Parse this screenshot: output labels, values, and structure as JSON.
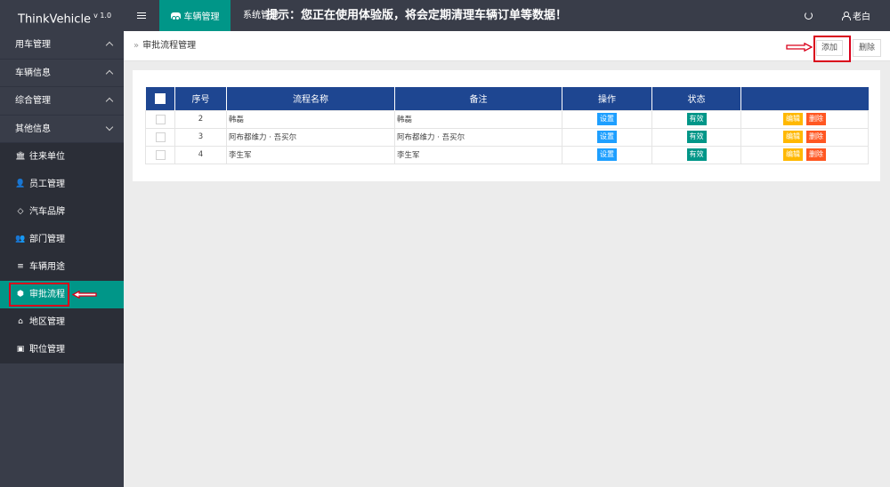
{
  "header": {
    "logo": "ThinkVehicle",
    "version": "v 1.0",
    "active_tab": "车辆管理",
    "system_tab": "系统管理",
    "notice": "提示：您正在使用体验版，将会定期清理车辆订单等数据！",
    "user_name": "老白"
  },
  "sidebar": {
    "groups": [
      {
        "label": "用车管理",
        "expanded": false
      },
      {
        "label": "车辆信息",
        "expanded": false
      },
      {
        "label": "综合管理",
        "expanded": false
      },
      {
        "label": "其他信息",
        "expanded": true
      }
    ],
    "sub_items": [
      {
        "label": "往来单位",
        "icon": "bank-icon"
      },
      {
        "label": "员工管理",
        "icon": "user-icon"
      },
      {
        "label": "汽车品牌",
        "icon": "diamond-icon"
      },
      {
        "label": "部门管理",
        "icon": "users-icon"
      },
      {
        "label": "车辆用途",
        "icon": "list-icon"
      },
      {
        "label": "审批流程",
        "icon": "android-icon",
        "active": true
      },
      {
        "label": "地区管理",
        "icon": "home-icon"
      },
      {
        "label": "职位管理",
        "icon": "camera-icon"
      }
    ]
  },
  "page": {
    "breadcrumb": "审批流程管理",
    "add_label": "添加",
    "delete_label": "删除"
  },
  "table": {
    "columns": [
      "",
      "序号",
      "流程名称",
      "备注",
      "操作",
      "状态",
      ""
    ],
    "rows": [
      {
        "id": "2",
        "name": "韩磊",
        "remark": "韩磊",
        "action": "设置",
        "status": "有效",
        "edit": "编辑",
        "delete": "删除"
      },
      {
        "id": "3",
        "name": "阿布都维力 · 吾买尔",
        "remark": "阿布都维力 · 吾买尔",
        "action": "设置",
        "status": "有效",
        "edit": "编辑",
        "delete": "删除"
      },
      {
        "id": "4",
        "name": "李生军",
        "remark": "李生军",
        "action": "设置",
        "status": "有效",
        "edit": "编辑",
        "delete": "删除"
      }
    ]
  },
  "colors": {
    "topbar": "#393d49",
    "accent": "#009688",
    "table_header": "#1e4691",
    "highlight": "#d9001b",
    "tag_blue": "#1e9fff",
    "tag_orange": "#ffb800",
    "tag_red": "#ff5722"
  }
}
